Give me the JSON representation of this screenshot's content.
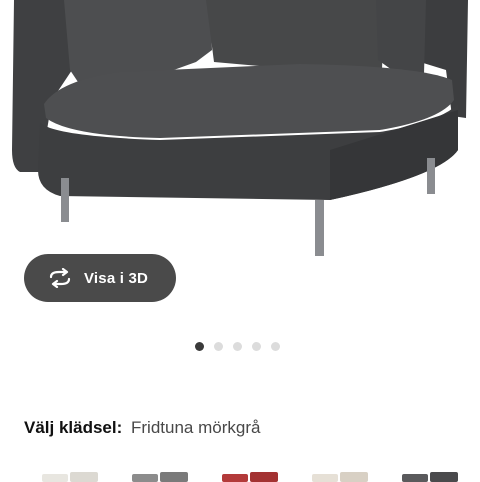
{
  "product_image": {
    "alt": "",
    "colors": {
      "fabric": "#4a4b4d",
      "fabric_dark": "#3b3c3e",
      "legs": "#8a8c90"
    }
  },
  "view_3d": {
    "label": "Visa i 3D",
    "icon": "rotate-3d-icon",
    "bg": "#4a4a4a"
  },
  "carousel": {
    "total": 5,
    "active_index": 0,
    "active_color": "#3a3a3a",
    "inactive_color": "#dcdcdc"
  },
  "fabric_selector": {
    "label": "Välj klädsel:",
    "value": "Fridtuna mörkgrå"
  },
  "swatch_colors": [
    "#e8e6e0",
    "#8c8c8c",
    "#b33a3a",
    "#e6e0d6",
    "#5a5a5c"
  ]
}
